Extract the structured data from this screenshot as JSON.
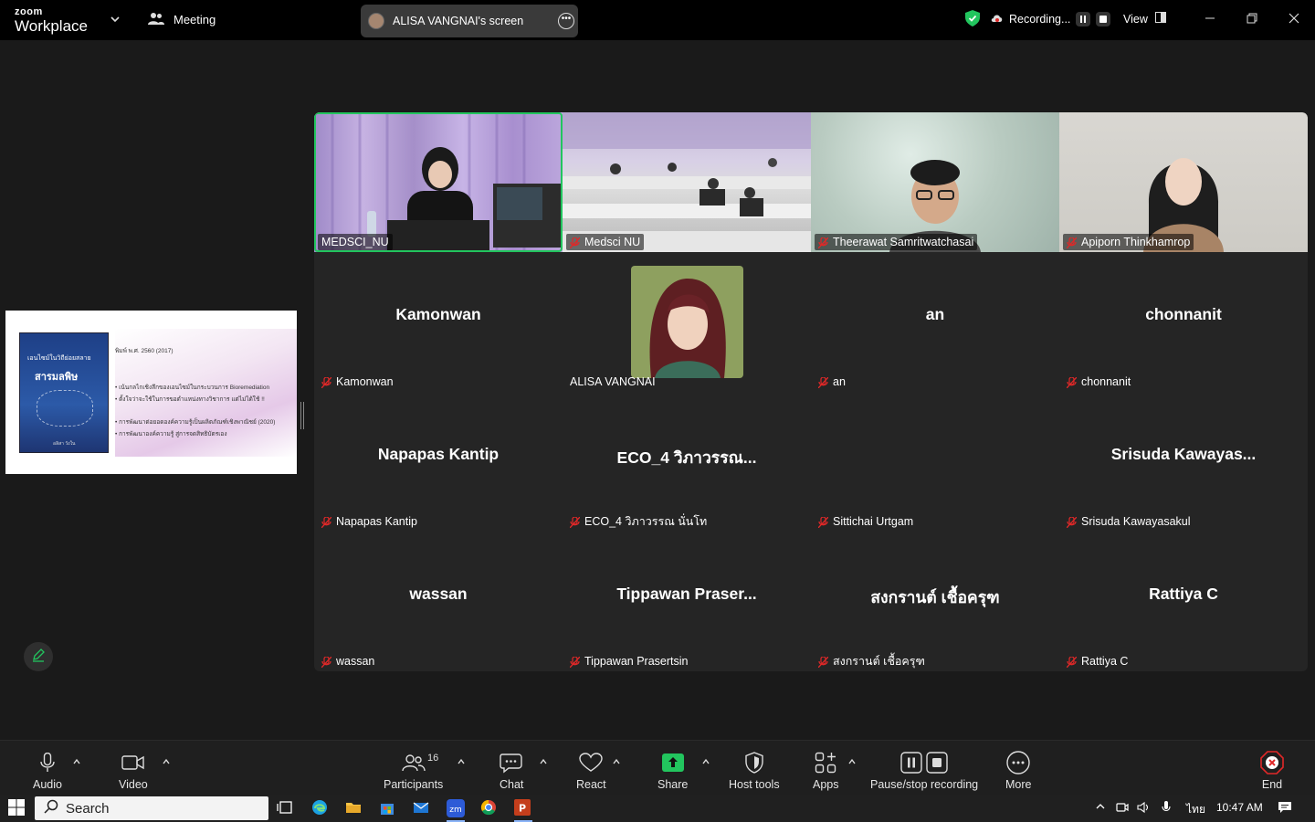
{
  "app": {
    "brand_top": "zoom",
    "brand_bottom": "Workplace",
    "meeting_label": "Meeting"
  },
  "share_pill": {
    "label": "ALISA VANGNAI's screen"
  },
  "recording": {
    "label": "Recording...",
    "status_color": "#22c55e"
  },
  "view": {
    "label": "View"
  },
  "grid_tiles": [
    {
      "name": "MEDSCI_NU",
      "video": true,
      "active": true,
      "muted": false
    },
    {
      "name": "Medsci NU",
      "video": true,
      "muted": true
    },
    {
      "name": "Theerawat Samritwatchasai",
      "video": true,
      "muted": true
    },
    {
      "name": "Apiporn Thinkhamrop",
      "video": true,
      "muted": true
    },
    {
      "name": "Kamonwan",
      "big": "Kamonwan",
      "muted": true
    },
    {
      "name": "ALISA VANGNAI",
      "photo": true,
      "muted": false
    },
    {
      "name": "an",
      "big": "an",
      "muted": true
    },
    {
      "name": "chonnanit",
      "big": "chonnanit",
      "muted": true
    },
    {
      "name": "Napapas Kantip",
      "big": "Napapas Kantip",
      "muted": true
    },
    {
      "name": "ECO_4 วิภาวรรณ นั่นโท",
      "big": "ECO_4 วิภาวรรณ...",
      "muted": true
    },
    {
      "name": "Sittichai Urtgam",
      "big": "",
      "muted": true
    },
    {
      "name": "Srisuda Kawayasakul",
      "big": "Srisuda Kawayas...",
      "muted": true
    },
    {
      "name": "wassan",
      "big": "wassan",
      "muted": true
    },
    {
      "name": "Tippawan Prasertsin",
      "big": "Tippawan Praser...",
      "muted": true
    },
    {
      "name": "สงกรานต์ เชื้อครุฑ",
      "big": "สงกรานต์ เชื้อครุฑ",
      "muted": true
    },
    {
      "name": "Rattiya C",
      "big": "Rattiya C",
      "muted": true
    }
  ],
  "shared_slide": {
    "book_title": "เอนไซม์ในวิถีย่อยสลาย",
    "book_subtitle": "สารมลพิษ",
    "book_author": "อลิสา วังใน",
    "year_line": "พิมพ์ พ.ศ. 2560 (2017)",
    "bullet1": "• เน้นกลไกเชิงลึกของเอนไซม์ในกระบวนการ Bioremediation",
    "bullet2": "• ตั้งใจว่าจะใช้ในการขอตำแหน่งทางวิชาการ แต่ไม่ได้ใช้ !!",
    "bullet3": "• การพัฒนาต่อยอดองค์ความรู้เป็นผลิตภัณฑ์เชิงพาณิชย์ (2020)",
    "bullet4": "• การพัฒนาองค์ความรู้ สู่การจดสิทธิบัตรเอง"
  },
  "toolbar": {
    "audio": "Audio",
    "video": "Video",
    "participants": "Participants",
    "participants_count": "16",
    "chat": "Chat",
    "react": "React",
    "share": "Share",
    "host_tools": "Host tools",
    "apps": "Apps",
    "pause_stop": "Pause/stop recording",
    "more": "More",
    "end": "End",
    "share_color": "#22c55e",
    "end_color": "#e02828"
  },
  "taskbar": {
    "search": "Search",
    "lang": "ไทย",
    "time": "10:47 AM"
  }
}
